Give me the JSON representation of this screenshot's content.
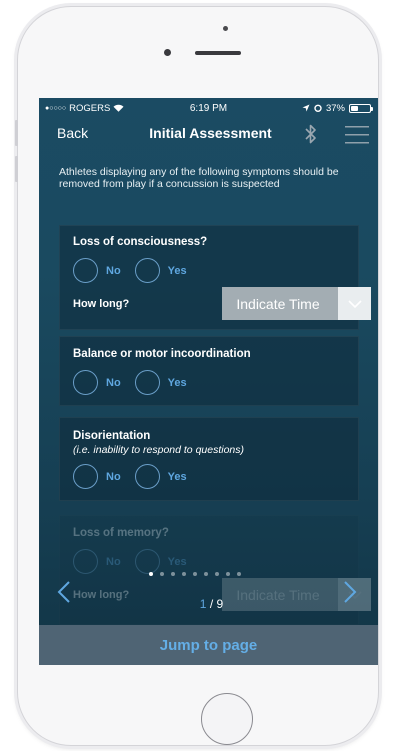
{
  "status_bar": {
    "carrier": "ROGERS",
    "time": "6:19 PM",
    "battery": "37%",
    "battery_level": 0.37
  },
  "nav": {
    "back_label": "Back",
    "title": "Initial Assessment",
    "icons": [
      "bluetooth-icon",
      "menu-icon"
    ]
  },
  "intro_text": "Athletes displaying any of the following symptoms should be removed from play if a concussion is suspected",
  "options": {
    "no": "No",
    "yes": "Yes"
  },
  "questions": [
    {
      "title": "Loss of consciousness?",
      "how_long_label": "How long?",
      "time_placeholder": "Indicate Time"
    },
    {
      "title": "Balance or motor incoordination"
    },
    {
      "title": "Disorientation",
      "subtitle": "(i.e. inability to respond to questions)"
    },
    {
      "title": "Loss of memory?",
      "how_long_label": "How long?",
      "time_placeholder": "Indicate Time"
    }
  ],
  "pager": {
    "current": "1",
    "separator": " / ",
    "total": "9",
    "dots_count": 9,
    "active_dot": 1
  },
  "jump_label": "Jump to page",
  "colors": {
    "accent": "#5fa7e0",
    "background": "#1a4a60",
    "jump_bar": "#4f6474"
  }
}
